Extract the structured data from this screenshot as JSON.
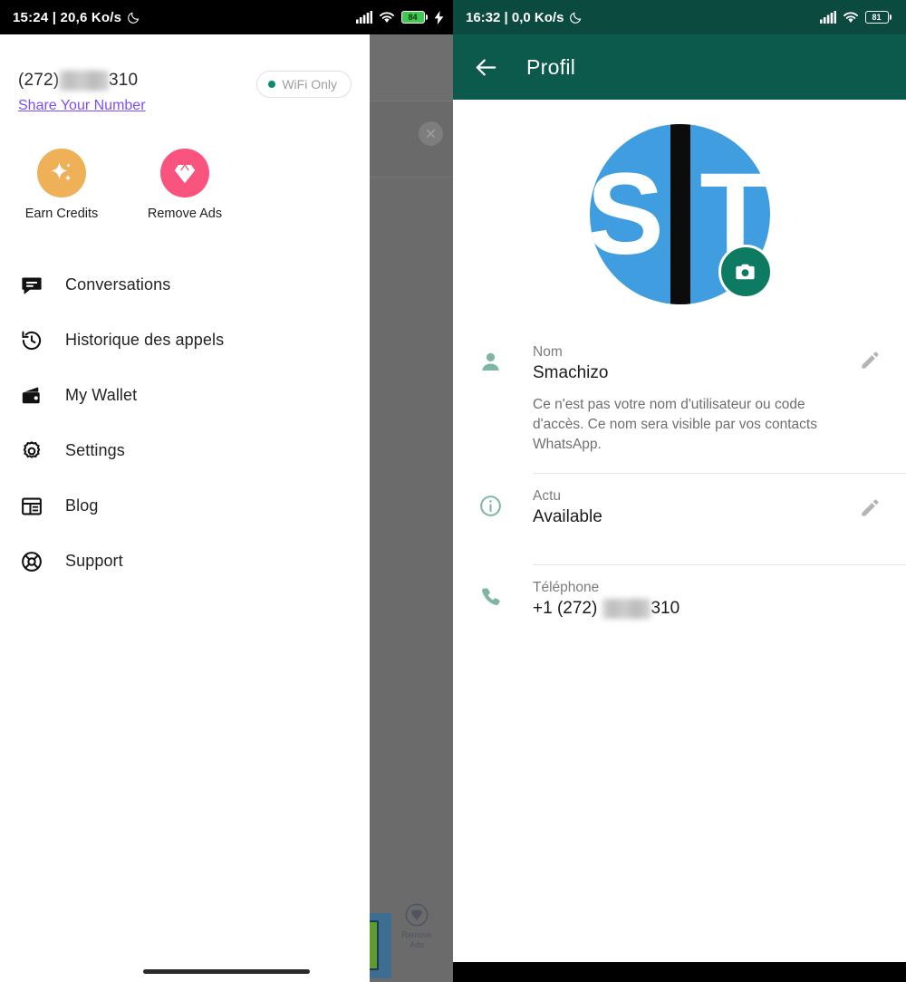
{
  "left": {
    "status_bar": {
      "time_and_speed": "15:24 | 20,6 Ko/s",
      "moon_icon": "moon-icon",
      "signal_icon": "signal-bars-icon",
      "wifi_icon": "wifi-icon",
      "battery_level": "84",
      "charging_icon": "charging-bolt-icon"
    },
    "drawer": {
      "phone_prefix": "(272)",
      "phone_masked": "▒▒▒▒",
      "phone_suffix": "310",
      "share_label": "Share Your Number",
      "wifi_pill_label": "WiFi Only",
      "quick_actions": [
        {
          "label": "Earn Credits",
          "icon": "sparkle-icon",
          "color": "#eeb158"
        },
        {
          "label": "Remove Ads",
          "icon": "diamond-icon",
          "color": "#f8547d"
        }
      ],
      "menu": [
        {
          "label": "Conversations",
          "icon": "chat-bubble-icon"
        },
        {
          "label": "Historique des appels",
          "icon": "call-history-icon"
        },
        {
          "label": "My Wallet",
          "icon": "wallet-icon"
        },
        {
          "label": "Settings",
          "icon": "gear-icon"
        },
        {
          "label": "Blog",
          "icon": "article-layout-icon"
        },
        {
          "label": "Support",
          "icon": "lifebuoy-icon"
        }
      ]
    },
    "background_app": {
      "close_icon": "close-circle-icon",
      "remove_ads_label": "Remove\nAds",
      "remove_ads_line1": "Remove",
      "remove_ads_line2": "Ads",
      "remove_ads_icon": "diamond-outline-icon"
    }
  },
  "right": {
    "status_bar": {
      "time_and_speed": "16:32 | 0,0 Ko/s",
      "moon_icon": "moon-icon",
      "signal_icon": "signal-bars-icon",
      "wifi_icon": "wifi-icon",
      "battery_level": "81"
    },
    "appbar": {
      "back_icon": "back-arrow-icon",
      "title": "Profil",
      "bg_color": "#0c5a4c"
    },
    "avatar": {
      "letters": "S T",
      "camera_icon": "camera-icon",
      "bg_color": "#3f9de0"
    },
    "fields": [
      {
        "icon": "person-icon",
        "label": "Nom",
        "value": "Smachizo",
        "help": "Ce n'est pas votre nom d'utilisateur ou code d'accès. Ce nom sera visible par vos contacts WhatsApp.",
        "edit_icon": "pencil-icon"
      },
      {
        "icon": "info-icon",
        "label": "Actu",
        "value": "Available",
        "edit_icon": "pencil-icon"
      },
      {
        "icon": "phone-icon",
        "label": "Téléphone",
        "value_prefix": "+1 (272)",
        "value_masked": "▒▒▒▒",
        "value_suffix": "310"
      }
    ]
  }
}
